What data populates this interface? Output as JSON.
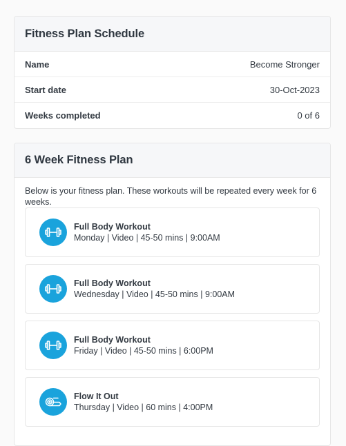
{
  "schedule": {
    "title": "Fitness Plan Schedule",
    "rows": [
      {
        "label": "Name",
        "value": "Become Stronger"
      },
      {
        "label": "Start date",
        "value": "30-Oct-2023"
      },
      {
        "label": "Weeks completed",
        "value": "0 of 6"
      }
    ]
  },
  "plan": {
    "title": "6 Week Fitness Plan",
    "intro": "Below is your fitness plan. These workouts will be repeated every week for 6 weeks.",
    "workouts": [
      {
        "title": "Full Body Workout",
        "details": "Monday | Video | 45-50 mins | 9:00AM",
        "icon": "dumbbell-icon"
      },
      {
        "title": "Full Body Workout",
        "details": "Wednesday | Video | 45-50 mins | 9:00AM",
        "icon": "dumbbell-icon"
      },
      {
        "title": "Full Body Workout",
        "details": "Friday | Video | 45-50 mins | 6:00PM",
        "icon": "dumbbell-icon"
      },
      {
        "title": "Flow It Out",
        "details": "Thursday | Video | 60 mins | 4:00PM",
        "icon": "yoga-mat-icon"
      }
    ]
  },
  "colors": {
    "icon_background": "#1aa3dc",
    "header_background": "#f6f7f9"
  }
}
